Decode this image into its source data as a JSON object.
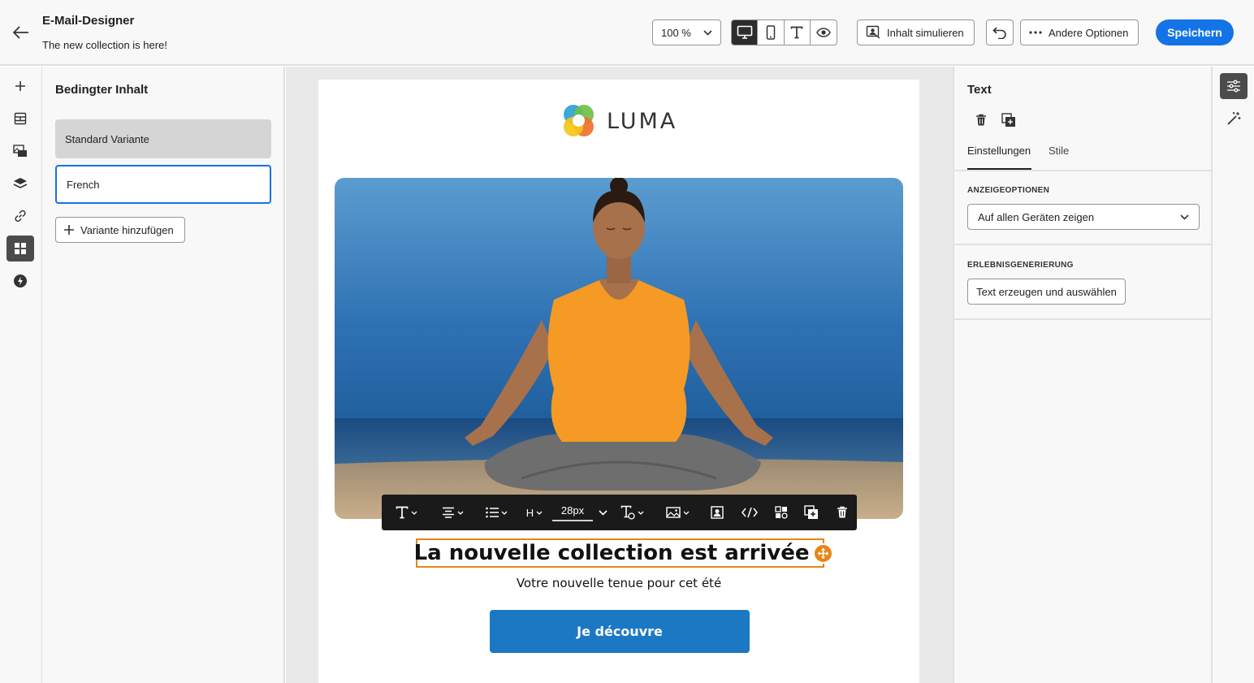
{
  "header": {
    "title": "E-Mail-Designer",
    "subtitle": "The new collection is here!",
    "zoom": "100 %",
    "simulate_label": "Inhalt simulieren",
    "more_options_label": "Andere Optionen",
    "save_label": "Speichern"
  },
  "conditional": {
    "title": "Bedingter Inhalt",
    "variants": [
      {
        "label": "Standard Variante",
        "state": "default"
      },
      {
        "label": "French",
        "state": "selected"
      }
    ],
    "add_label": "Variante hinzufügen"
  },
  "email": {
    "logo_text": "LUMA",
    "headline": "La nouvelle collection est arrivée !",
    "subline": "Votre nouvelle tenue pour cet été",
    "cta": "Je découvre",
    "toolbar": {
      "heading_label": "H",
      "font_size": "28px"
    }
  },
  "properties": {
    "title": "Text",
    "tabs": [
      "Einstellungen",
      "Stile"
    ],
    "active_tab": "Einstellungen",
    "display_options_label": "ANZEIGEOPTIONEN",
    "display_value": "Auf allen Geräten zeigen",
    "generation_label": "ERLEBNISGENERIERUNG",
    "generate_button": "Text erzeugen und auswählen"
  },
  "colors": {
    "accent": "#1473e6",
    "selection": "#e68619",
    "cta": "#1d78c4",
    "toolbar": "#1a1a1a"
  }
}
